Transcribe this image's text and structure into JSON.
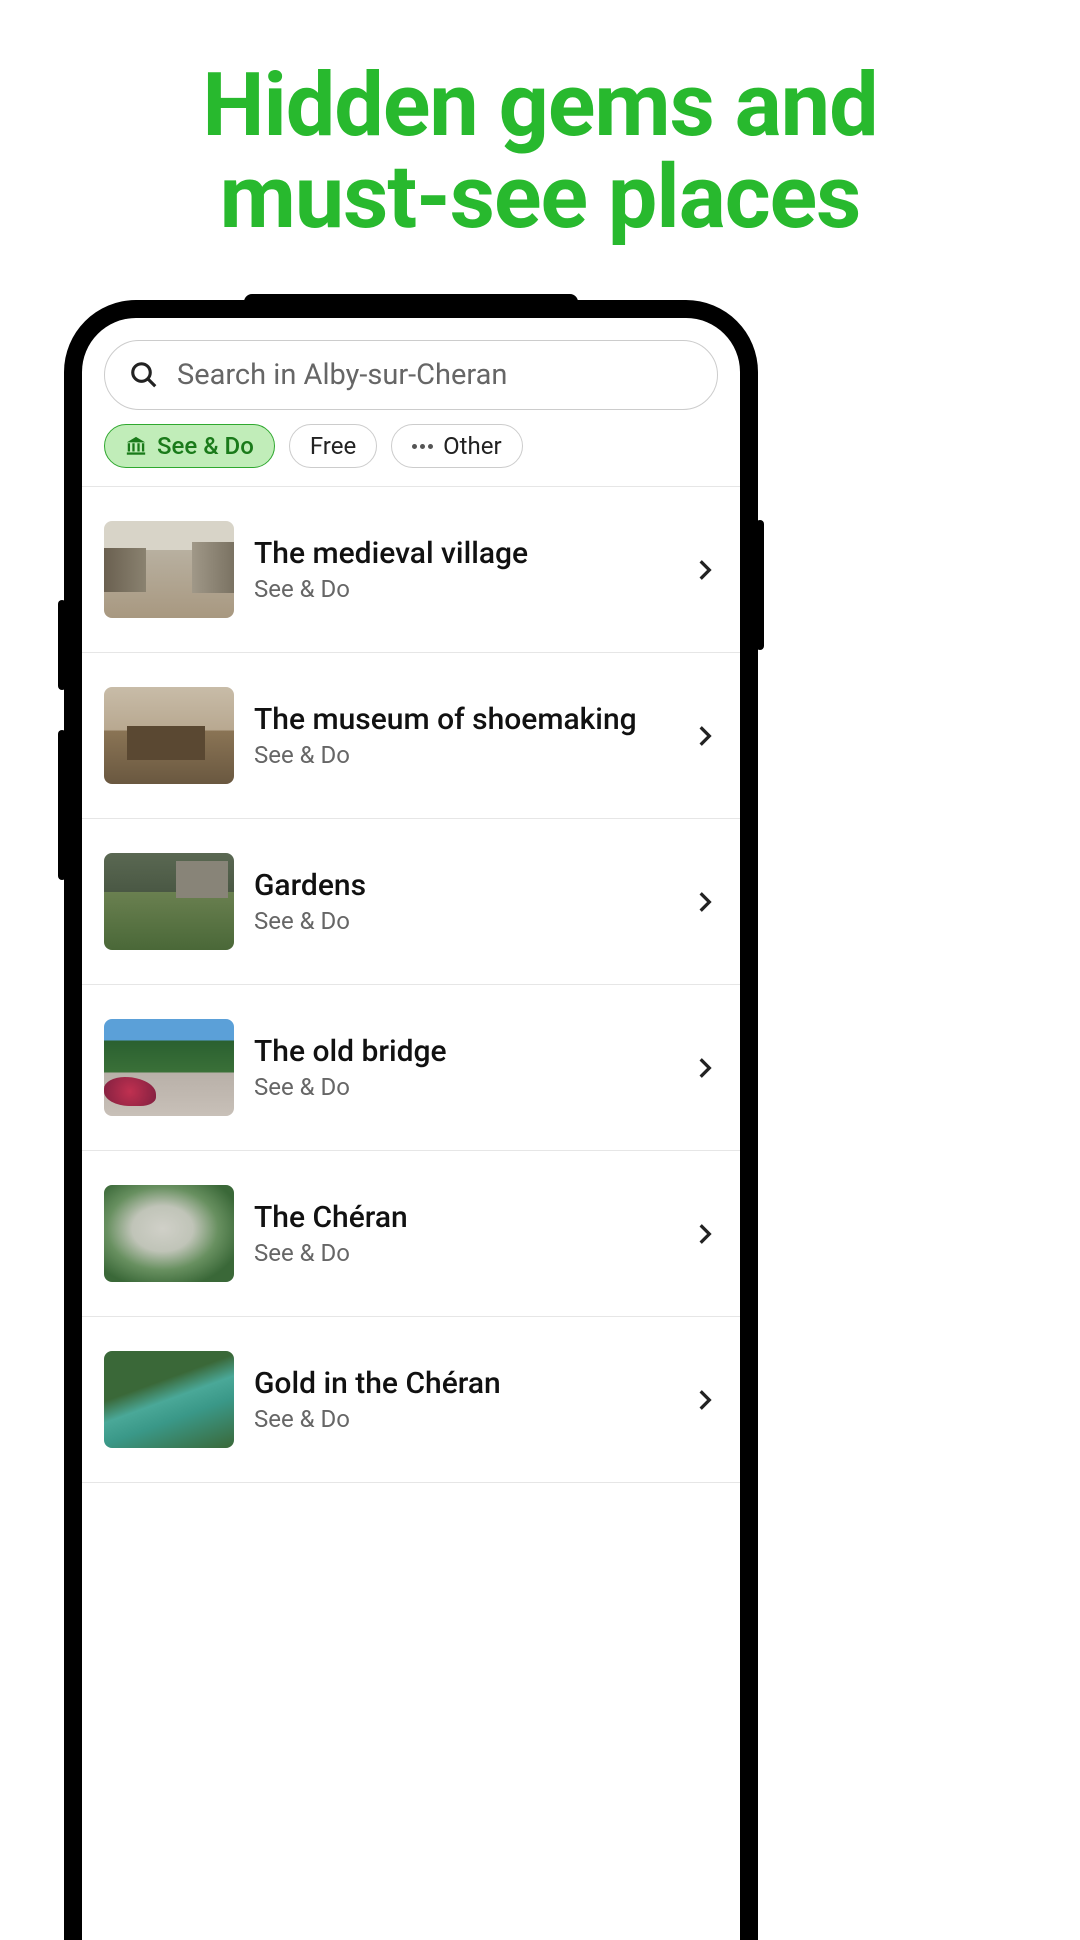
{
  "hero": {
    "title_line1": "Hidden gems and",
    "title_line2": "must-see places"
  },
  "search": {
    "placeholder": "Search in Alby-sur-Cheran"
  },
  "filters": {
    "see_do": "See & Do",
    "free": "Free",
    "other": "Other"
  },
  "list": [
    {
      "title": "The medieval village",
      "category": "See & Do",
      "thumb": "village"
    },
    {
      "title": "The museum of shoemaking",
      "category": "See & Do",
      "thumb": "museum"
    },
    {
      "title": "Gardens",
      "category": "See & Do",
      "thumb": "gardens"
    },
    {
      "title": "The old bridge",
      "category": "See & Do",
      "thumb": "bridge"
    },
    {
      "title": "The Chéran",
      "category": "See & Do",
      "thumb": "cheran"
    },
    {
      "title": "Gold in the Chéran",
      "category": "See & Do",
      "thumb": "gold"
    }
  ]
}
